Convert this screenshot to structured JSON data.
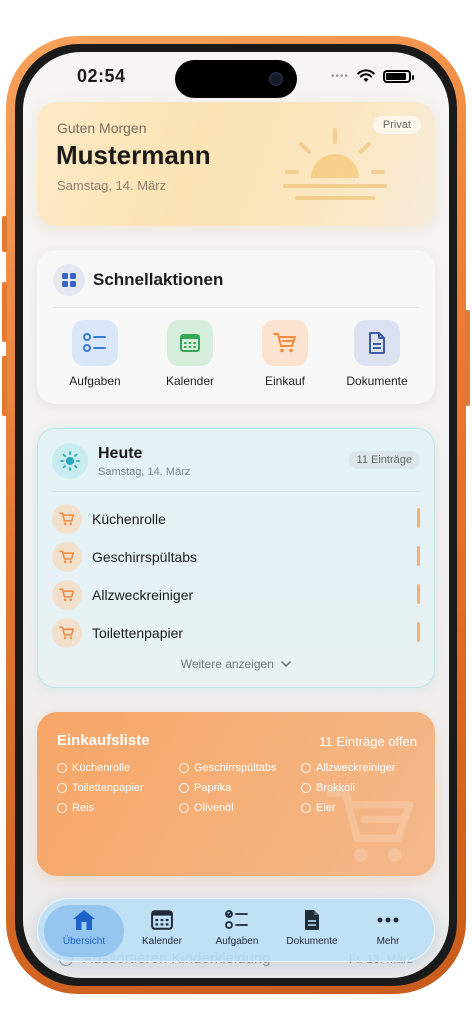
{
  "status_bar": {
    "time": "02:54",
    "signal": "••••"
  },
  "greeting": {
    "salutation": "Guten Morgen",
    "name": "Mustermann",
    "date": "Samstag, 14. März",
    "badge": "Privat"
  },
  "quick_actions": {
    "title": "Schnellaktionen",
    "items": [
      {
        "label": "Aufgaben",
        "icon": "checklist-icon",
        "color": "#3a7bd5"
      },
      {
        "label": "Kalender",
        "icon": "calendar-icon",
        "color": "#34a853"
      },
      {
        "label": "Einkauf",
        "icon": "cart-icon",
        "color": "#f08a3c"
      },
      {
        "label": "Dokumente",
        "icon": "document-icon",
        "color": "#3f5aa8"
      }
    ]
  },
  "today": {
    "title": "Heute",
    "date": "Samstag, 14. März",
    "badge": "11 Einträge",
    "items": [
      {
        "label": "Küchenrolle"
      },
      {
        "label": "Geschirrspültabs"
      },
      {
        "label": "Allzweckreiniger"
      },
      {
        "label": "Toilettenpapier"
      }
    ],
    "more": "Weitere anzeigen"
  },
  "shopping": {
    "title": "Einkaufsliste",
    "count": "11 Einträge offen",
    "items": [
      "Küchenrolle",
      "Geschirrspültabs",
      "Allzweckreiniger",
      "Toilettenpapier",
      "Paprika",
      "Brokkoli",
      "Reis",
      "Olivenöl",
      "Eier"
    ]
  },
  "background_row": {
    "label": "Aussortieren Kinderkleidung",
    "date": "Fr. 13. März"
  },
  "tabbar": {
    "items": [
      {
        "label": "Übersicht",
        "icon": "home-icon",
        "active": true
      },
      {
        "label": "Kalender",
        "icon": "calendar-icon",
        "active": false
      },
      {
        "label": "Aufgaben",
        "icon": "checklist-icon",
        "active": false
      },
      {
        "label": "Dokumente",
        "icon": "document-icon",
        "active": false
      },
      {
        "label": "Mehr",
        "icon": "more-icon",
        "active": false
      }
    ]
  },
  "colors": {
    "accent_blue": "#1d62c8",
    "orange": "#f08a3c",
    "teal": "#bfe4ea",
    "greeting_bg": "#fbe3b4"
  }
}
